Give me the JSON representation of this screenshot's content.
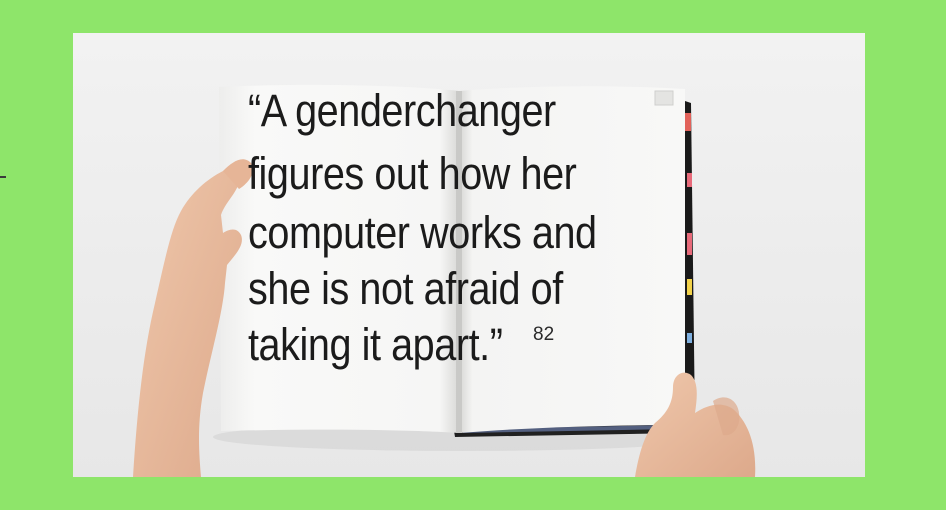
{
  "colors": {
    "frame_green": "#8EE56A",
    "backdrop": "#EDEDED",
    "page": "#F8F8F7",
    "ink": "#1B1B1B",
    "skin": "#E9BFA2"
  },
  "book": {
    "quote_lines": [
      "“A genderchanger",
      "figures out how her",
      "computer works and",
      "she is not afraid of",
      "taking it apart.”"
    ],
    "page_number": "82"
  },
  "icons": [
    "left-hand-icon",
    "right-hand-icon"
  ]
}
